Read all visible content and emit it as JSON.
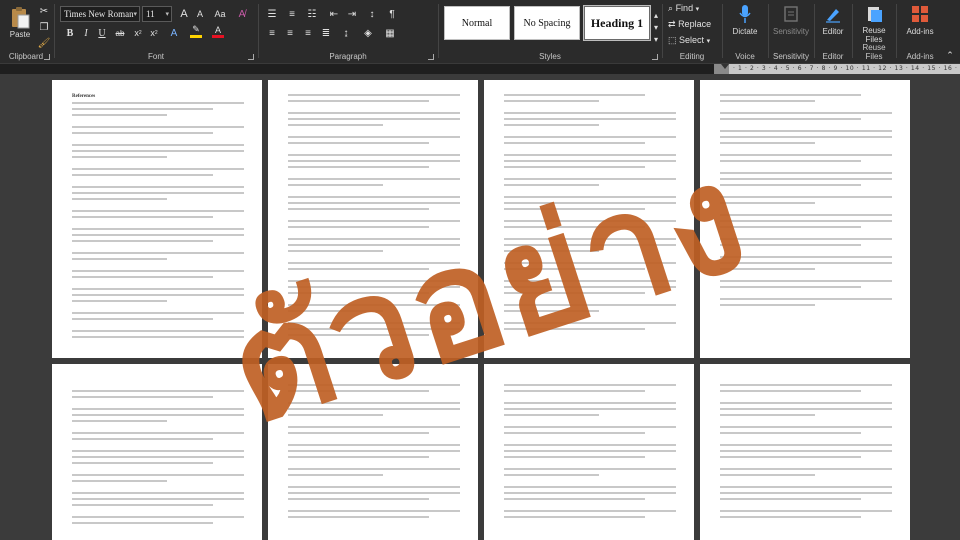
{
  "ribbon": {
    "clipboard": {
      "label": "Clipboard",
      "paste_label": "Paste"
    },
    "font": {
      "label": "Font",
      "font_name": "Times New Roman",
      "font_size": "11",
      "grow_label": "A",
      "shrink_label": "A",
      "case_label": "Aa",
      "bold": "B",
      "italic": "I",
      "underline": "U",
      "strike": "ab",
      "subscript": "x",
      "superscript": "x",
      "highlight_color": "#ffd400",
      "font_color": "#e81123"
    },
    "paragraph": {
      "label": "Paragraph"
    },
    "styles": {
      "label": "Styles",
      "items": [
        {
          "label": "Normal"
        },
        {
          "label": "No Spacing"
        },
        {
          "label": "Heading 1"
        }
      ]
    },
    "editing": {
      "label": "Editing",
      "find_label": "Find",
      "replace_label": "Replace",
      "select_label": "Select"
    },
    "voice": {
      "label": "Voice",
      "dictate_label": "Dictate"
    },
    "sensitivity": {
      "label": "Sensitivity",
      "button_label": "Sensitivity"
    },
    "editor": {
      "label": "Editor",
      "button_label": "Editor"
    },
    "reuse_files": {
      "label": "Reuse Files",
      "button_label": "Reuse\nFiles"
    },
    "addins": {
      "label": "Add-ins",
      "button_label": "Add-ins"
    }
  },
  "ruler": {
    "numbers": "· 1 · 2 · 3 · 4 · 5 · 6 · 7 · 8 · 9 · 10 · 11 · 12 · 13 · 14 · 15 · 16 · 17 · 18 ·"
  },
  "document": {
    "first_page_heading": "References"
  },
  "watermark": {
    "text": "ตัวอย่าง",
    "color": "#bf6024"
  }
}
